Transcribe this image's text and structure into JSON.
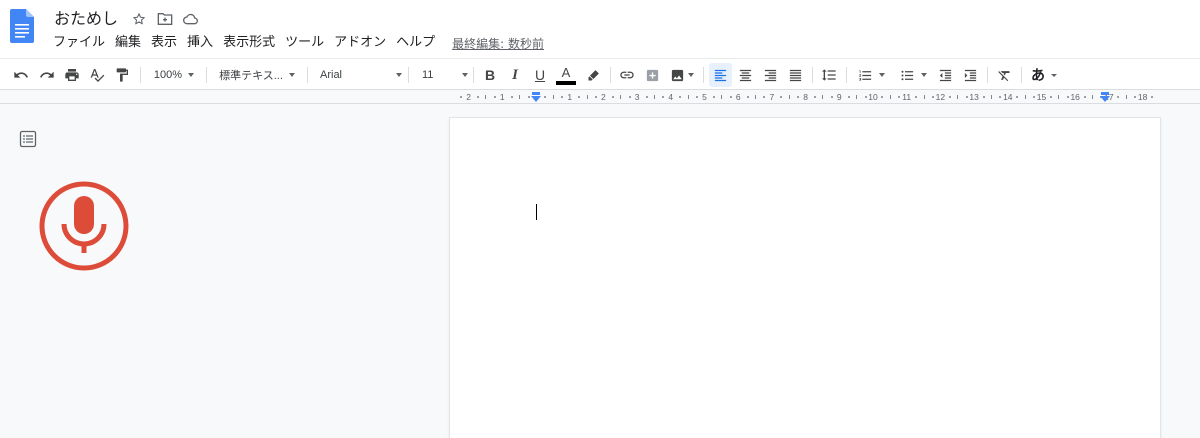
{
  "header": {
    "title": "おためし",
    "menu": [
      "ファイル",
      "編集",
      "表示",
      "挿入",
      "表示形式",
      "ツール",
      "アドオン",
      "ヘルプ"
    ],
    "last_edit": "最終編集: 数秒前"
  },
  "toolbar": {
    "zoom": "100%",
    "style": "標準テキス...",
    "font": "Arial",
    "font_size": "11",
    "bold": "B",
    "italic": "I",
    "underline": "U",
    "text_color": "A",
    "input_tools": "あ"
  },
  "ruler": {
    "labels": [
      "2",
      "1",
      "1",
      "2",
      "3",
      "4",
      "5",
      "6",
      "7",
      "8",
      "9",
      "10",
      "11",
      "12",
      "13",
      "14",
      "15",
      "16",
      "17",
      "18"
    ]
  },
  "colors": {
    "accent": "#1a73e8",
    "mic": "#dd4b39",
    "docs_blue": "#4285f4"
  }
}
